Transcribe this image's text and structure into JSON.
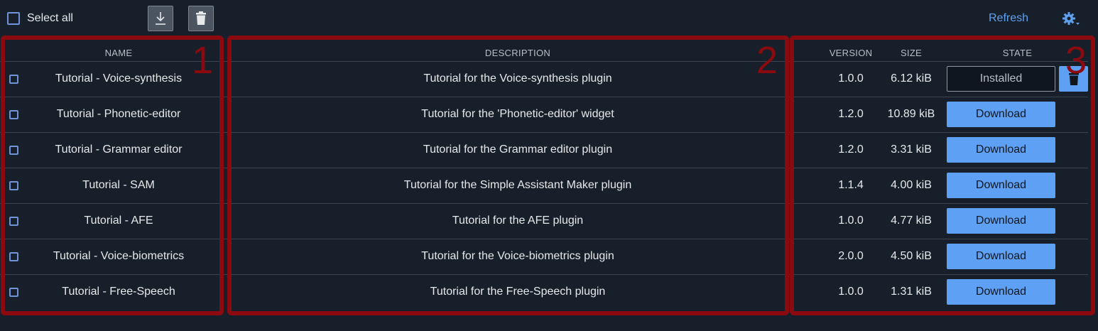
{
  "toolbar": {
    "select_all_label": "Select all",
    "download_icon": "download-icon",
    "delete_icon": "trash-icon",
    "refresh_label": "Refresh",
    "settings_icon": "gear-icon"
  },
  "table": {
    "headers": {
      "name": "NAME",
      "description": "DESCRIPTION",
      "version": "VERSION",
      "size": "SIZE",
      "state": "STATE"
    },
    "rows": [
      {
        "name": "Tutorial - Voice-synthesis",
        "description": "Tutorial for the Voice-synthesis plugin",
        "version": "1.0.0",
        "size": "6.12 kiB",
        "state": "Installed"
      },
      {
        "name": "Tutorial - Phonetic-editor",
        "description": "Tutorial for the 'Phonetic-editor' widget",
        "version": "1.2.0",
        "size": "10.89 kiB",
        "state": "Download"
      },
      {
        "name": "Tutorial - Grammar editor",
        "description": "Tutorial for the Grammar editor plugin",
        "version": "1.2.0",
        "size": "3.31 kiB",
        "state": "Download"
      },
      {
        "name": "Tutorial - SAM",
        "description": "Tutorial for the Simple Assistant Maker plugin",
        "version": "1.1.4",
        "size": "4.00 kiB",
        "state": "Download"
      },
      {
        "name": "Tutorial - AFE",
        "description": "Tutorial for the AFE plugin",
        "version": "1.0.0",
        "size": "4.77 kiB",
        "state": "Download"
      },
      {
        "name": "Tutorial - Voice-biometrics",
        "description": "Tutorial for the Voice-biometrics plugin",
        "version": "2.0.0",
        "size": "4.50 kiB",
        "state": "Download"
      },
      {
        "name": "Tutorial - Free-Speech",
        "description": "Tutorial for the Free-Speech plugin",
        "version": "1.0.0",
        "size": "1.31 kiB",
        "state": "Download"
      }
    ]
  },
  "annotations": {
    "labels": [
      "1",
      "2",
      "3"
    ],
    "color": "#8b0a0f"
  },
  "colors": {
    "background": "#17202a",
    "accent": "#5ea0f4",
    "link": "#5fa1ef"
  }
}
